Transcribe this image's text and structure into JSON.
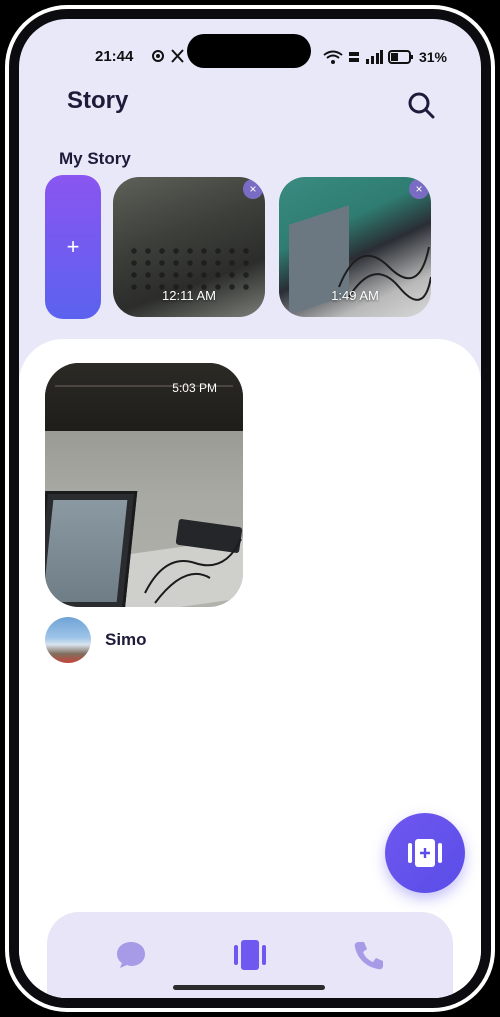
{
  "status_bar": {
    "time": "21:44",
    "battery": "31%"
  },
  "header": {
    "title": "Story",
    "search_icon": "search-icon"
  },
  "my_story": {
    "label": "My Story",
    "add_label": "+",
    "items": [
      {
        "time": "12:11 AM",
        "close": "×"
      },
      {
        "time": "1:49 AM",
        "close": "×"
      }
    ]
  },
  "feed": {
    "stories": [
      {
        "time": "5:03 PM",
        "author": "Simo"
      }
    ]
  },
  "fab": {
    "icon": "add-story-icon"
  },
  "bottom_nav": {
    "items": [
      {
        "icon": "chat-icon",
        "active": false
      },
      {
        "icon": "stories-icon",
        "active": true
      },
      {
        "icon": "phone-icon",
        "active": false
      }
    ]
  },
  "colors": {
    "accent": "#5b4de8",
    "accent_light": "#a79ae6",
    "header_bg": "#e9e8f9",
    "nav_bg": "#e7e5f7",
    "text": "#1e1b3a"
  }
}
